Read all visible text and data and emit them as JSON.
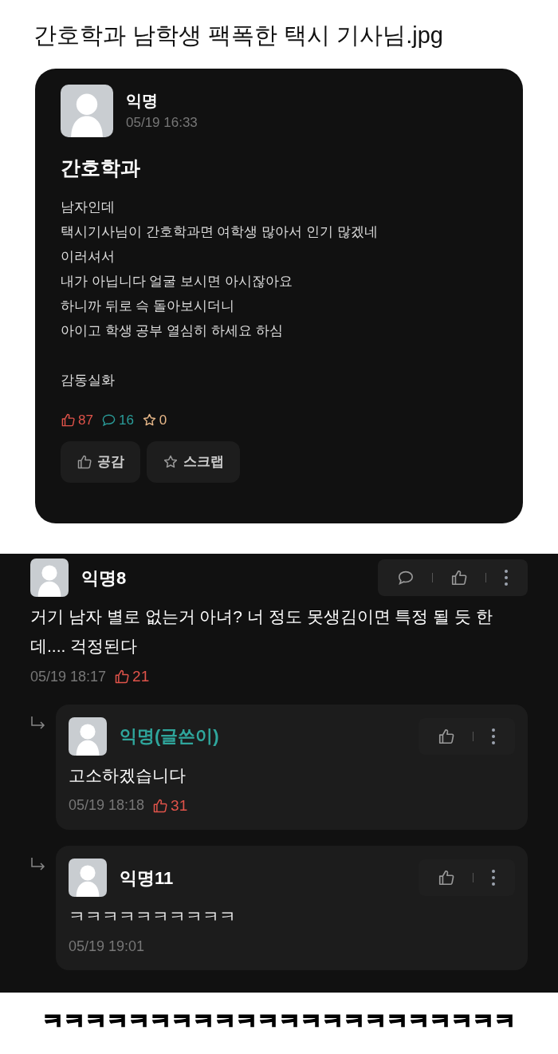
{
  "headline": "간호학과 남학생 팩폭한 택시 기사님.jpg",
  "post": {
    "author": "익명",
    "time": "05/19 16:33",
    "title": "간호학과",
    "paragraphs": [
      [
        "남자인데",
        "택시기사님이 간호학과면 여학생 많아서 인기 많겠네",
        "이러셔서",
        "내가 아닙니다 얼굴 보시면 아시잖아요",
        "하니까 뒤로 슥 돌아보시더니",
        "아이고 학생 공부 열심히 하세요 하심"
      ],
      [
        "감동실화"
      ]
    ],
    "stats": [
      {
        "kind": "like",
        "text": "87"
      },
      {
        "kind": "comment",
        "text": "16"
      },
      {
        "kind": "scrap",
        "text": "0"
      }
    ],
    "buttons": [
      {
        "kind": "like",
        "label": "공감"
      },
      {
        "kind": "scrap",
        "label": "스크랩"
      }
    ]
  },
  "comments": [
    {
      "kind": "comment",
      "author": "익명8",
      "writer": false,
      "text": "거기 남자 별로 없는거 아녀? 너 정도 못생김이면 특정 될 듯 한데.... 걱정된다",
      "time": "05/19 18:17",
      "likes": "21"
    },
    {
      "kind": "reply",
      "author": "익명(글쓴이)",
      "writer": true,
      "text": "고소하겠습니다",
      "time": "05/19 18:18",
      "likes": "31"
    },
    {
      "kind": "reply",
      "author": "익명11",
      "writer": false,
      "text": "ㅋㅋㅋㅋㅋㅋㅋㅋㅋㅋ",
      "time": "05/19 19:01"
    }
  ],
  "footer": "ㅋㅋㅋㅋㅋㅋㅋㅋㅋㅋㅋㅋㅋㅋㅋㅋㅋㅋㅋㅋㅋㅋ"
}
